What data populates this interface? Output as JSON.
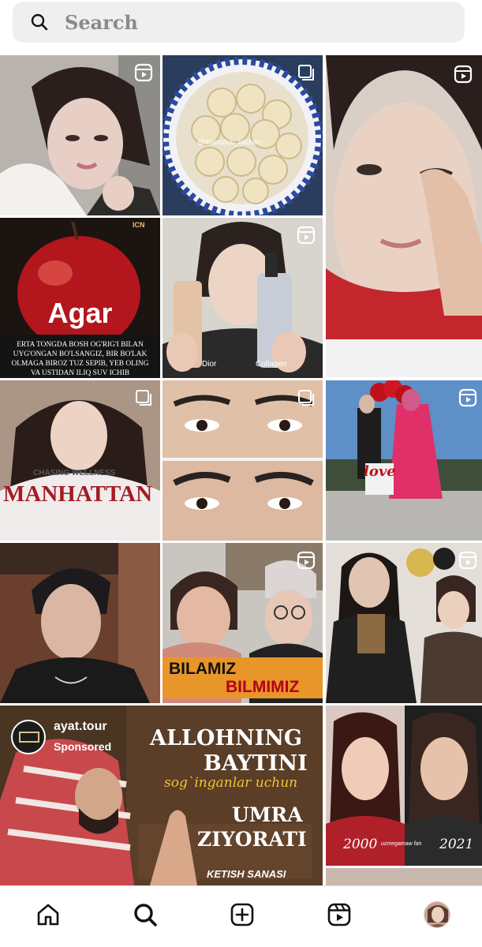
{
  "search": {
    "placeholder": "Search"
  },
  "tiles": {
    "apple": {
      "headline": "Agar",
      "logo": "ICN",
      "caption_lines": [
        "ERTA TONGDA BOSH OG'RIG'I BILAN",
        "UYG'ONGAN BO'LSANGIZ, BIR BO'LAK",
        "OLMAGA BIROZ TUZ SEPIB, YEB OLING",
        "VA USTIDAN ILIQ SUV ICHIB"
      ]
    },
    "dumplings": {
      "watermark": "@daardduu_kitchen"
    },
    "serum": {
      "left_label": "Dior",
      "right_label": "Collagen"
    },
    "sweater": {
      "text_top": "CHASING WELLNESS",
      "text_main": "MANHATTAN"
    },
    "love": {
      "sign": "love"
    },
    "bilamiz": {
      "line1": "BILAMIZ",
      "line2": "BILMIMIZ"
    },
    "ad": {
      "account": "ayat.tour",
      "sponsored": "Sponsored",
      "line1": "ALLOHNING",
      "line2": "BAYTINI",
      "line3": "sog`inganlar uchun",
      "line4": "UMRA",
      "line5": "ZIYORATI",
      "line6": "KETISH SANASI"
    },
    "compare": {
      "left_year": "2000",
      "right_year": "2021",
      "middle": "uzmegamaw fan"
    }
  },
  "nav": {
    "items": [
      "home",
      "search",
      "create",
      "reels",
      "profile"
    ]
  },
  "colors": {
    "accent": "#000000",
    "search_bg": "#efefef"
  }
}
